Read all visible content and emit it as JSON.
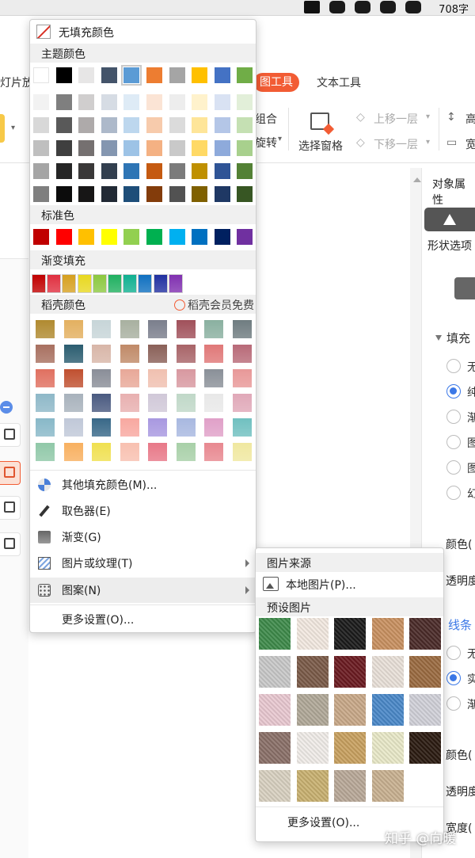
{
  "status_bar": {
    "word_count": "708字"
  },
  "ribbon": {
    "tab_slide_show": "灯片放",
    "tab_picture_tools": "图工具",
    "tab_text_tools": "文本工具",
    "group": "组合",
    "rotate": "旋转",
    "selection_pane": "选择窗格",
    "bring_forward": "上移一层",
    "send_backward": "下移一层",
    "height": "高",
    "width": "宽"
  },
  "right_panel": {
    "title": "对象属性",
    "shape_options": "形状选项",
    "fill_section": "填充",
    "fill_option_1": "无",
    "fill_option_2": "纯",
    "fill_option_3": "渐",
    "fill_option_4": "图",
    "fill_option_5": "图",
    "fill_option_6": "幻",
    "color_label": "颜色(",
    "transparency_label": "透明度",
    "line_section": "线条",
    "line_option_1": "无",
    "line_option_2": "实",
    "line_option_3": "渐",
    "line_color_label": "颜色(",
    "line_transparency_label": "透明度",
    "line_width_label": "宽度("
  },
  "color_menu": {
    "no_fill": "无填充颜色",
    "theme_colors_title": "主题颜色",
    "theme_colors": [
      [
        "#ffffff",
        "#000000",
        "#e7e6e6",
        "#44546a",
        "#5b9bd5",
        "#ed7d31",
        "#a5a5a5",
        "#ffc000",
        "#4472c4",
        "#70ad47"
      ],
      [
        "#f2f2f2",
        "#7f7f7f",
        "#d0cece",
        "#d6dce4",
        "#deebf6",
        "#fbe4d5",
        "#ededed",
        "#fff2cc",
        "#d9e2f3",
        "#e2efd9"
      ],
      [
        "#d8d8d8",
        "#595959",
        "#aeaaaa",
        "#adb9ca",
        "#bdd7ee",
        "#f7cbac",
        "#dbdbdb",
        "#fee599",
        "#b4c6e7",
        "#c5e0b3"
      ],
      [
        "#bfbfbf",
        "#3f3f3f",
        "#757070",
        "#8496b0",
        "#9dc3e6",
        "#f4b183",
        "#c9c9c9",
        "#ffd965",
        "#8eaadb",
        "#a8d08d"
      ],
      [
        "#a5a5a5",
        "#262626",
        "#3a3838",
        "#323f4f",
        "#2e75b5",
        "#c55a11",
        "#7b7b7b",
        "#bf9000",
        "#2f5496",
        "#538135"
      ],
      [
        "#7f7f7f",
        "#0c0c0c",
        "#171616",
        "#222a35",
        "#1e4e79",
        "#833c0b",
        "#525252",
        "#7f6000",
        "#1f3864",
        "#375623"
      ]
    ],
    "standard_colors_title": "标准色",
    "standard_colors": [
      "#c00000",
      "#ff0000",
      "#ffc000",
      "#ffff00",
      "#92d050",
      "#00b050",
      "#00b0f0",
      "#0070c0",
      "#002060",
      "#7030a0"
    ],
    "gradient_fill_title": "渐变填充",
    "gradient_colors": [
      "#c00000",
      "#e03040",
      "#d6a020",
      "#e8d820",
      "#8cc840",
      "#20b060",
      "#10b090",
      "#1070c0",
      "#2030a0",
      "#8030b0"
    ],
    "docer_colors_title": "稻壳颜色",
    "docer_member_label": "稻壳会员免费",
    "docer_colors": [
      [
        "#b08a30",
        "#e3b060",
        "#c7d5d8",
        "#a8b0a0",
        "#7a7e8c",
        "#a0505a",
        "#8ab0a0",
        "#6f7c80"
      ],
      [
        "#a87060",
        "#2b5d70",
        "#d8b6a8",
        "#c08a68",
        "#8a6058",
        "#a86468",
        "#e07878",
        "#b86a78"
      ],
      [
        "#e07060",
        "#c05030",
        "#8a8e98",
        "#e8a898",
        "#f0c0b0",
        "#d898a0",
        "#8a9098",
        "#e89898"
      ],
      [
        "#8eb8c8",
        "#a8b2bc",
        "#4a5a80",
        "#e8b0b0",
        "#d0c8d8",
        "#c0d8c8",
        "#e8e8e8",
        "#e0a8b8"
      ],
      [
        "#88b8c8",
        "#c0c8d8",
        "#386888",
        "#f8a8a0",
        "#a898e0",
        "#a8b8e0",
        "#e0a0c8",
        "#70c0c0"
      ],
      [
        "#90c8a8",
        "#f8b060",
        "#f0e050",
        "#f8c0b0",
        "#e87888",
        "#a8d0a8",
        "#e88890",
        "#f0e8a0"
      ]
    ],
    "more_fill_colors": "其他填充颜色(M)...",
    "eyedropper": "取色器(E)",
    "gradient": "渐变(G)",
    "picture_or_texture": "图片或纹理(T)",
    "pattern": "图案(N)",
    "more_settings": "更多设置(O)..."
  },
  "picture_submenu": {
    "picture_source_title": "图片来源",
    "local_picture": "本地图片(P)...",
    "preset_pictures_title": "预设图片",
    "textures": [
      [
        "#3e8a4a",
        "#f2e8e0",
        "#1a1a1a",
        "#c89060",
        "#4a2a28"
      ],
      [
        "#c8c8c8",
        "#7a5a48",
        "#6a1a20",
        "#e8e0d8",
        "#9a6a40"
      ],
      [
        "#e8c8d0",
        "#b0a898",
        "#c8a888",
        "#4a88c8",
        "#d0d0d8"
      ],
      [
        "#8a7068",
        "#f0ece8",
        "#c8a060",
        "#e8e8c8",
        "#2a1a10"
      ],
      [
        "#d8d0c0",
        "#c8b070",
        "#b8a898",
        "#c8b090"
      ]
    ],
    "more_settings": "更多设置(O)..."
  },
  "watermark": "知乎 @向暖"
}
